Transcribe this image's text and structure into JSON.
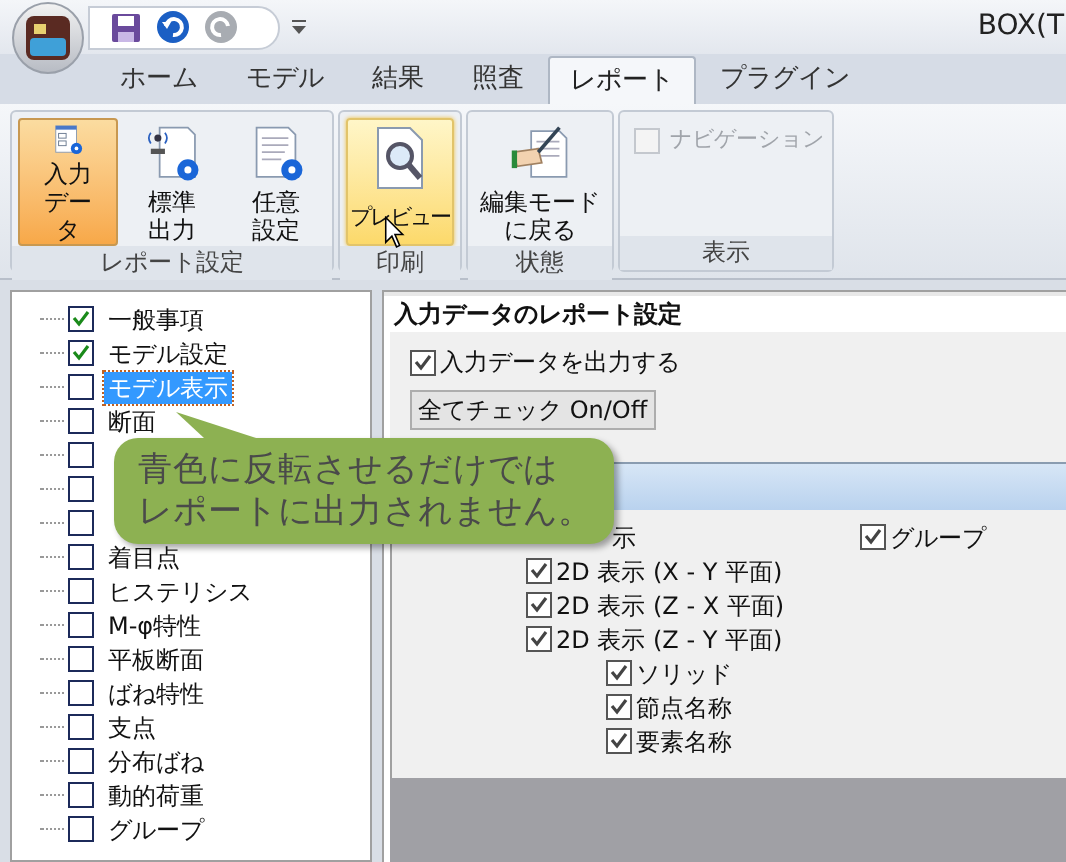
{
  "window": {
    "title": "BOX(T"
  },
  "tabs": [
    {
      "label": "ホーム",
      "selected": false
    },
    {
      "label": "モデル",
      "selected": false
    },
    {
      "label": "結果",
      "selected": false
    },
    {
      "label": "照査",
      "selected": false
    },
    {
      "label": "レポート",
      "selected": true
    },
    {
      "label": "プラグイン",
      "selected": false
    }
  ],
  "ribbon": {
    "groups": [
      {
        "label": "レポート設定",
        "items": [
          {
            "kind": "large_button",
            "label": "入力データ",
            "selected": true,
            "hovered": false
          },
          {
            "kind": "large_button",
            "label": "標準出力",
            "selected": false,
            "hovered": false
          },
          {
            "kind": "large_button",
            "label": "任意設定",
            "selected": false,
            "hovered": false
          }
        ]
      },
      {
        "label": "印刷",
        "items": [
          {
            "kind": "large_button",
            "label": "プレビュー",
            "selected": false,
            "hovered": true
          }
        ]
      },
      {
        "label": "状態",
        "items": [
          {
            "kind": "large_button",
            "label": "編集モードに戻る",
            "selected": false,
            "hovered": false
          }
        ]
      },
      {
        "label": "表示",
        "items": [
          {
            "kind": "checkbox",
            "label": "ナビゲーション",
            "checked": false,
            "disabled": true
          }
        ]
      }
    ]
  },
  "tree": {
    "items": [
      {
        "label": "一般事項",
        "checked": true,
        "selected": false
      },
      {
        "label": "モデル設定",
        "checked": true,
        "selected": false
      },
      {
        "label": "モデル表示",
        "checked": false,
        "selected": true
      },
      {
        "label": "断面",
        "checked": false,
        "selected": false
      },
      {
        "checked": false,
        "selected": false
      },
      {
        "checked": false,
        "selected": false
      },
      {
        "checked": false,
        "selected": false
      },
      {
        "label": "着目点",
        "checked": false,
        "selected": false
      },
      {
        "label": "ヒステリシス",
        "checked": false,
        "selected": false
      },
      {
        "label": "M-φ特性",
        "checked": false,
        "selected": false
      },
      {
        "label": "平板断面",
        "checked": false,
        "selected": false
      },
      {
        "label": "ばね特性",
        "checked": false,
        "selected": false
      },
      {
        "label": "支点",
        "checked": false,
        "selected": false
      },
      {
        "label": "分布ばね",
        "checked": false,
        "selected": false
      },
      {
        "label": "動的荷重",
        "checked": false,
        "selected": false
      },
      {
        "label": "グループ",
        "checked": false,
        "selected": false
      }
    ]
  },
  "panel": {
    "title": "入力データのレポート設定",
    "output_checkbox": {
      "label": "入力データを出力する",
      "checked": true
    },
    "toggle_button": "全てチェック On/Off",
    "partial_label": "示",
    "group_option": {
      "label": "グループ",
      "checked": true
    },
    "view_options": [
      {
        "label": "2D 表示 (X - Y 平面)",
        "checked": true
      },
      {
        "label": "2D 表示 (Z - X 平面)",
        "checked": true
      },
      {
        "label": "2D 表示 (Z - Y 平面)",
        "checked": true,
        "children": [
          {
            "label": "ソリッド",
            "checked": true
          },
          {
            "label": "節点名称",
            "checked": true
          },
          {
            "label": "要素名称",
            "checked": true
          }
        ]
      }
    ]
  },
  "callout": {
    "lines": [
      "青色に反転させるだけでは",
      "レポートに出力されません。"
    ]
  }
}
